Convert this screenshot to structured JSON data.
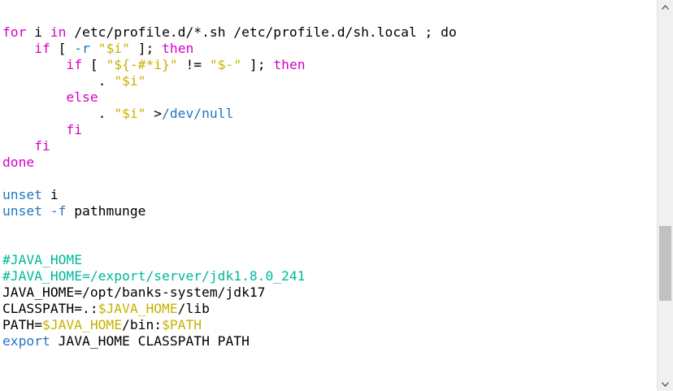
{
  "colors": {
    "keyword": "#d400c8",
    "builtin": "#1f76c2",
    "string": "#c7b200",
    "variable": "#c7b200",
    "comment": "#00b89a",
    "path": "#1f76c2",
    "text": "#000000",
    "background": "#ffffff"
  },
  "lines": [
    [
      {
        "t": "for",
        "c": "keyword"
      },
      {
        "t": " i ",
        "c": "text"
      },
      {
        "t": "in",
        "c": "keyword"
      },
      {
        "t": " /etc/profile.d/*.sh /etc/profile.d/sh.local ; do",
        "c": "text"
      }
    ],
    [
      {
        "t": "    ",
        "c": "text"
      },
      {
        "t": "if",
        "c": "keyword"
      },
      {
        "t": " [ ",
        "c": "text"
      },
      {
        "t": "-r",
        "c": "builtin"
      },
      {
        "t": " ",
        "c": "text"
      },
      {
        "t": "\"$i\"",
        "c": "string"
      },
      {
        "t": " ]; ",
        "c": "text"
      },
      {
        "t": "then",
        "c": "keyword"
      }
    ],
    [
      {
        "t": "        ",
        "c": "text"
      },
      {
        "t": "if",
        "c": "keyword"
      },
      {
        "t": " [ ",
        "c": "text"
      },
      {
        "t": "\"${-#*i}\"",
        "c": "string"
      },
      {
        "t": " != ",
        "c": "text"
      },
      {
        "t": "\"$-\"",
        "c": "string"
      },
      {
        "t": " ]; ",
        "c": "text"
      },
      {
        "t": "then",
        "c": "keyword"
      }
    ],
    [
      {
        "t": "            . ",
        "c": "text"
      },
      {
        "t": "\"$i\"",
        "c": "string"
      }
    ],
    [
      {
        "t": "        ",
        "c": "text"
      },
      {
        "t": "else",
        "c": "keyword"
      }
    ],
    [
      {
        "t": "            . ",
        "c": "text"
      },
      {
        "t": "\"$i\"",
        "c": "string"
      },
      {
        "t": " >",
        "c": "text"
      },
      {
        "t": "/dev/null",
        "c": "path"
      }
    ],
    [
      {
        "t": "        ",
        "c": "text"
      },
      {
        "t": "fi",
        "c": "keyword"
      }
    ],
    [
      {
        "t": "    ",
        "c": "text"
      },
      {
        "t": "fi",
        "c": "keyword"
      }
    ],
    [
      {
        "t": "done",
        "c": "keyword"
      }
    ],
    [],
    [
      {
        "t": "unset",
        "c": "builtin"
      },
      {
        "t": " i",
        "c": "text"
      }
    ],
    [
      {
        "t": "unset",
        "c": "builtin"
      },
      {
        "t": " ",
        "c": "text"
      },
      {
        "t": "-f",
        "c": "builtin"
      },
      {
        "t": " pathmunge",
        "c": "text"
      }
    ],
    [],
    [],
    [
      {
        "t": "#JAVA_HOME",
        "c": "comment"
      }
    ],
    [
      {
        "t": "#JAVA_HOME=/export/server/jdk1.8.0_241",
        "c": "comment"
      }
    ],
    [
      {
        "t": "JAVA_HOME=/opt/banks-system/jdk17",
        "c": "text"
      }
    ],
    [
      {
        "t": "CLASSPATH=.:",
        "c": "text"
      },
      {
        "t": "$JAVA_HOME",
        "c": "variable"
      },
      {
        "t": "/lib",
        "c": "text"
      }
    ],
    [
      {
        "t": "PATH=",
        "c": "text"
      },
      {
        "t": "$JAVA_HOME",
        "c": "variable"
      },
      {
        "t": "/bin:",
        "c": "text"
      },
      {
        "t": "$PATH",
        "c": "variable"
      }
    ],
    [
      {
        "t": "export",
        "c": "builtin"
      },
      {
        "t": " JAVA_HOME CLASSPATH PATH",
        "c": "text"
      }
    ]
  ],
  "scrollbar": {
    "up_icon": "triangle-up-icon",
    "down_icon": "triangle-down-icon",
    "position_fraction": 0.6
  }
}
